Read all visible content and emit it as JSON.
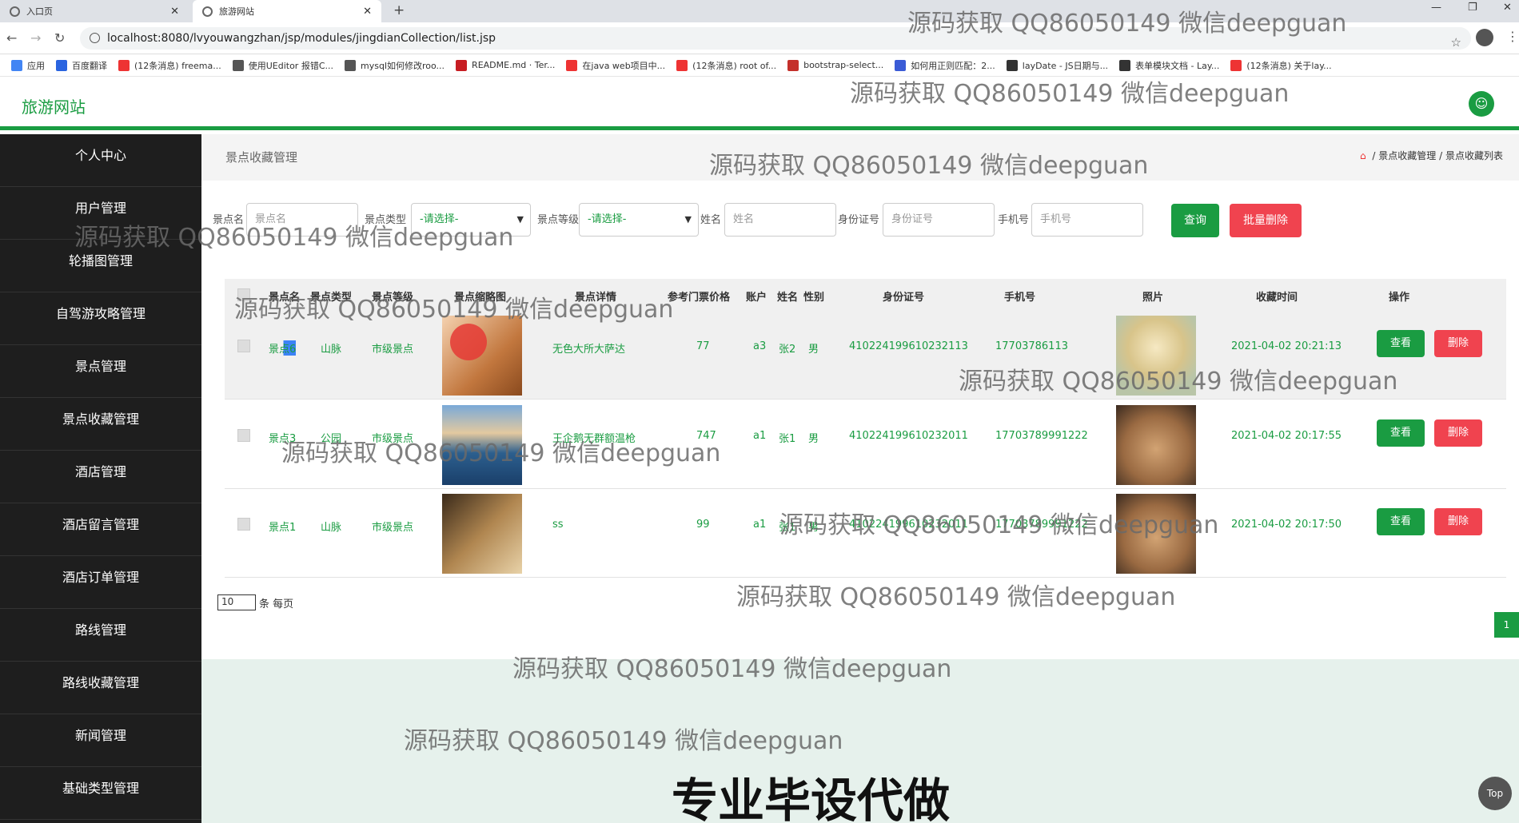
{
  "browser": {
    "tabs": [
      {
        "label": "入口页"
      },
      {
        "label": "旅游网站"
      }
    ],
    "new_tab": "+",
    "url": "localhost:8080/lvyouwangzhan/jsp/modules/jingdianCollection/list.jsp",
    "bookmarks": [
      {
        "label": "应用",
        "color": "#4285f4"
      },
      {
        "label": "百度翻译",
        "color": "#2a64e0"
      },
      {
        "label": "(12条消息) freema...",
        "color": "#e33"
      },
      {
        "label": "使用UEditor 报错C...",
        "color": "#555"
      },
      {
        "label": "mysql如何修改roo...",
        "color": "#555"
      },
      {
        "label": "README.md · Ter...",
        "color": "#c71d23"
      },
      {
        "label": "在java web项目中...",
        "color": "#e33"
      },
      {
        "label": "(12条消息) root of...",
        "color": "#e33"
      },
      {
        "label": "bootstrap-select...",
        "color": "#c4302b"
      },
      {
        "label": "如何用正则匹配：2...",
        "color": "#3a5bd6"
      },
      {
        "label": "layDate - JS日期与...",
        "color": "#333"
      },
      {
        "label": "表单模块文档 - Lay...",
        "color": "#333"
      },
      {
        "label": "(12条消息) 关于lay...",
        "color": "#e33"
      }
    ]
  },
  "header": {
    "logo": "旅游网站"
  },
  "sidebar": {
    "items": [
      {
        "label": "个人中心"
      },
      {
        "label": "用户管理"
      },
      {
        "label": "轮播图管理"
      },
      {
        "label": "自驾游攻略管理"
      },
      {
        "label": "景点管理"
      },
      {
        "label": "景点收藏管理"
      },
      {
        "label": "酒店管理"
      },
      {
        "label": "酒店留言管理"
      },
      {
        "label": "酒店订单管理"
      },
      {
        "label": "路线管理"
      },
      {
        "label": "路线收藏管理"
      },
      {
        "label": "新闻管理"
      },
      {
        "label": "基础类型管理"
      }
    ]
  },
  "page": {
    "title": "景点收藏管理",
    "breadcrumb": {
      "home_icon": "⌂",
      "sep": "/",
      "level1": "景点收藏管理",
      "level2": "景点收藏列表"
    }
  },
  "filters": {
    "name_label": "景点名",
    "name_placeholder": "景点名",
    "type_label": "景点类型",
    "type_value": "-请选择-",
    "level_label": "景点等级",
    "level_value": "-请选择-",
    "uname_label": "姓名",
    "uname_placeholder": "姓名",
    "idcard_label": "身份证号",
    "idcard_placeholder": "身份证号",
    "phone_label": "手机号",
    "phone_placeholder": "手机号",
    "query_btn": "查询",
    "batch_delete_btn": "批量删除"
  },
  "table": {
    "columns": [
      "景点名",
      "景点类型",
      "景点等级",
      "景点缩略图",
      "景点详情",
      "参考门票价格",
      "账户",
      "姓名",
      "性别",
      "身份证号",
      "手机号",
      "照片",
      "收藏时间",
      "操作"
    ],
    "rows": [
      {
        "name": "景点6",
        "type": "山脉",
        "level": "市级景点",
        "detail": "无色大所大萨达",
        "price": "77",
        "account": "a3",
        "uname": "张2",
        "sex": "男",
        "idcard": "410224199610232113",
        "phone": "17703786113",
        "time": "2021-04-02 20:21:13"
      },
      {
        "name": "景点3",
        "type": "公园",
        "level": "市级景点",
        "detail": "王企鹅无群额温枪",
        "price": "747",
        "account": "a1",
        "uname": "张1",
        "sex": "男",
        "idcard": "410224199610232011",
        "phone": "17703789991222",
        "time": "2021-04-02 20:17:55"
      },
      {
        "name": "景点1",
        "type": "山脉",
        "level": "市级景点",
        "detail": "ss",
        "price": "99",
        "account": "a1",
        "uname": "张1",
        "sex": "男",
        "idcard": "410224199610232011",
        "phone": "17703789991222",
        "time": "2021-04-02 20:17:50"
      }
    ],
    "view_btn": "查看",
    "delete_btn": "删除"
  },
  "pagination": {
    "page_size": "10",
    "per_page_text": "条 每页",
    "current_page": "1"
  },
  "top_link": "Top",
  "watermarks": {
    "text": "源码获取 QQ86050149 微信deepguan",
    "big": "专业毕设代做"
  }
}
